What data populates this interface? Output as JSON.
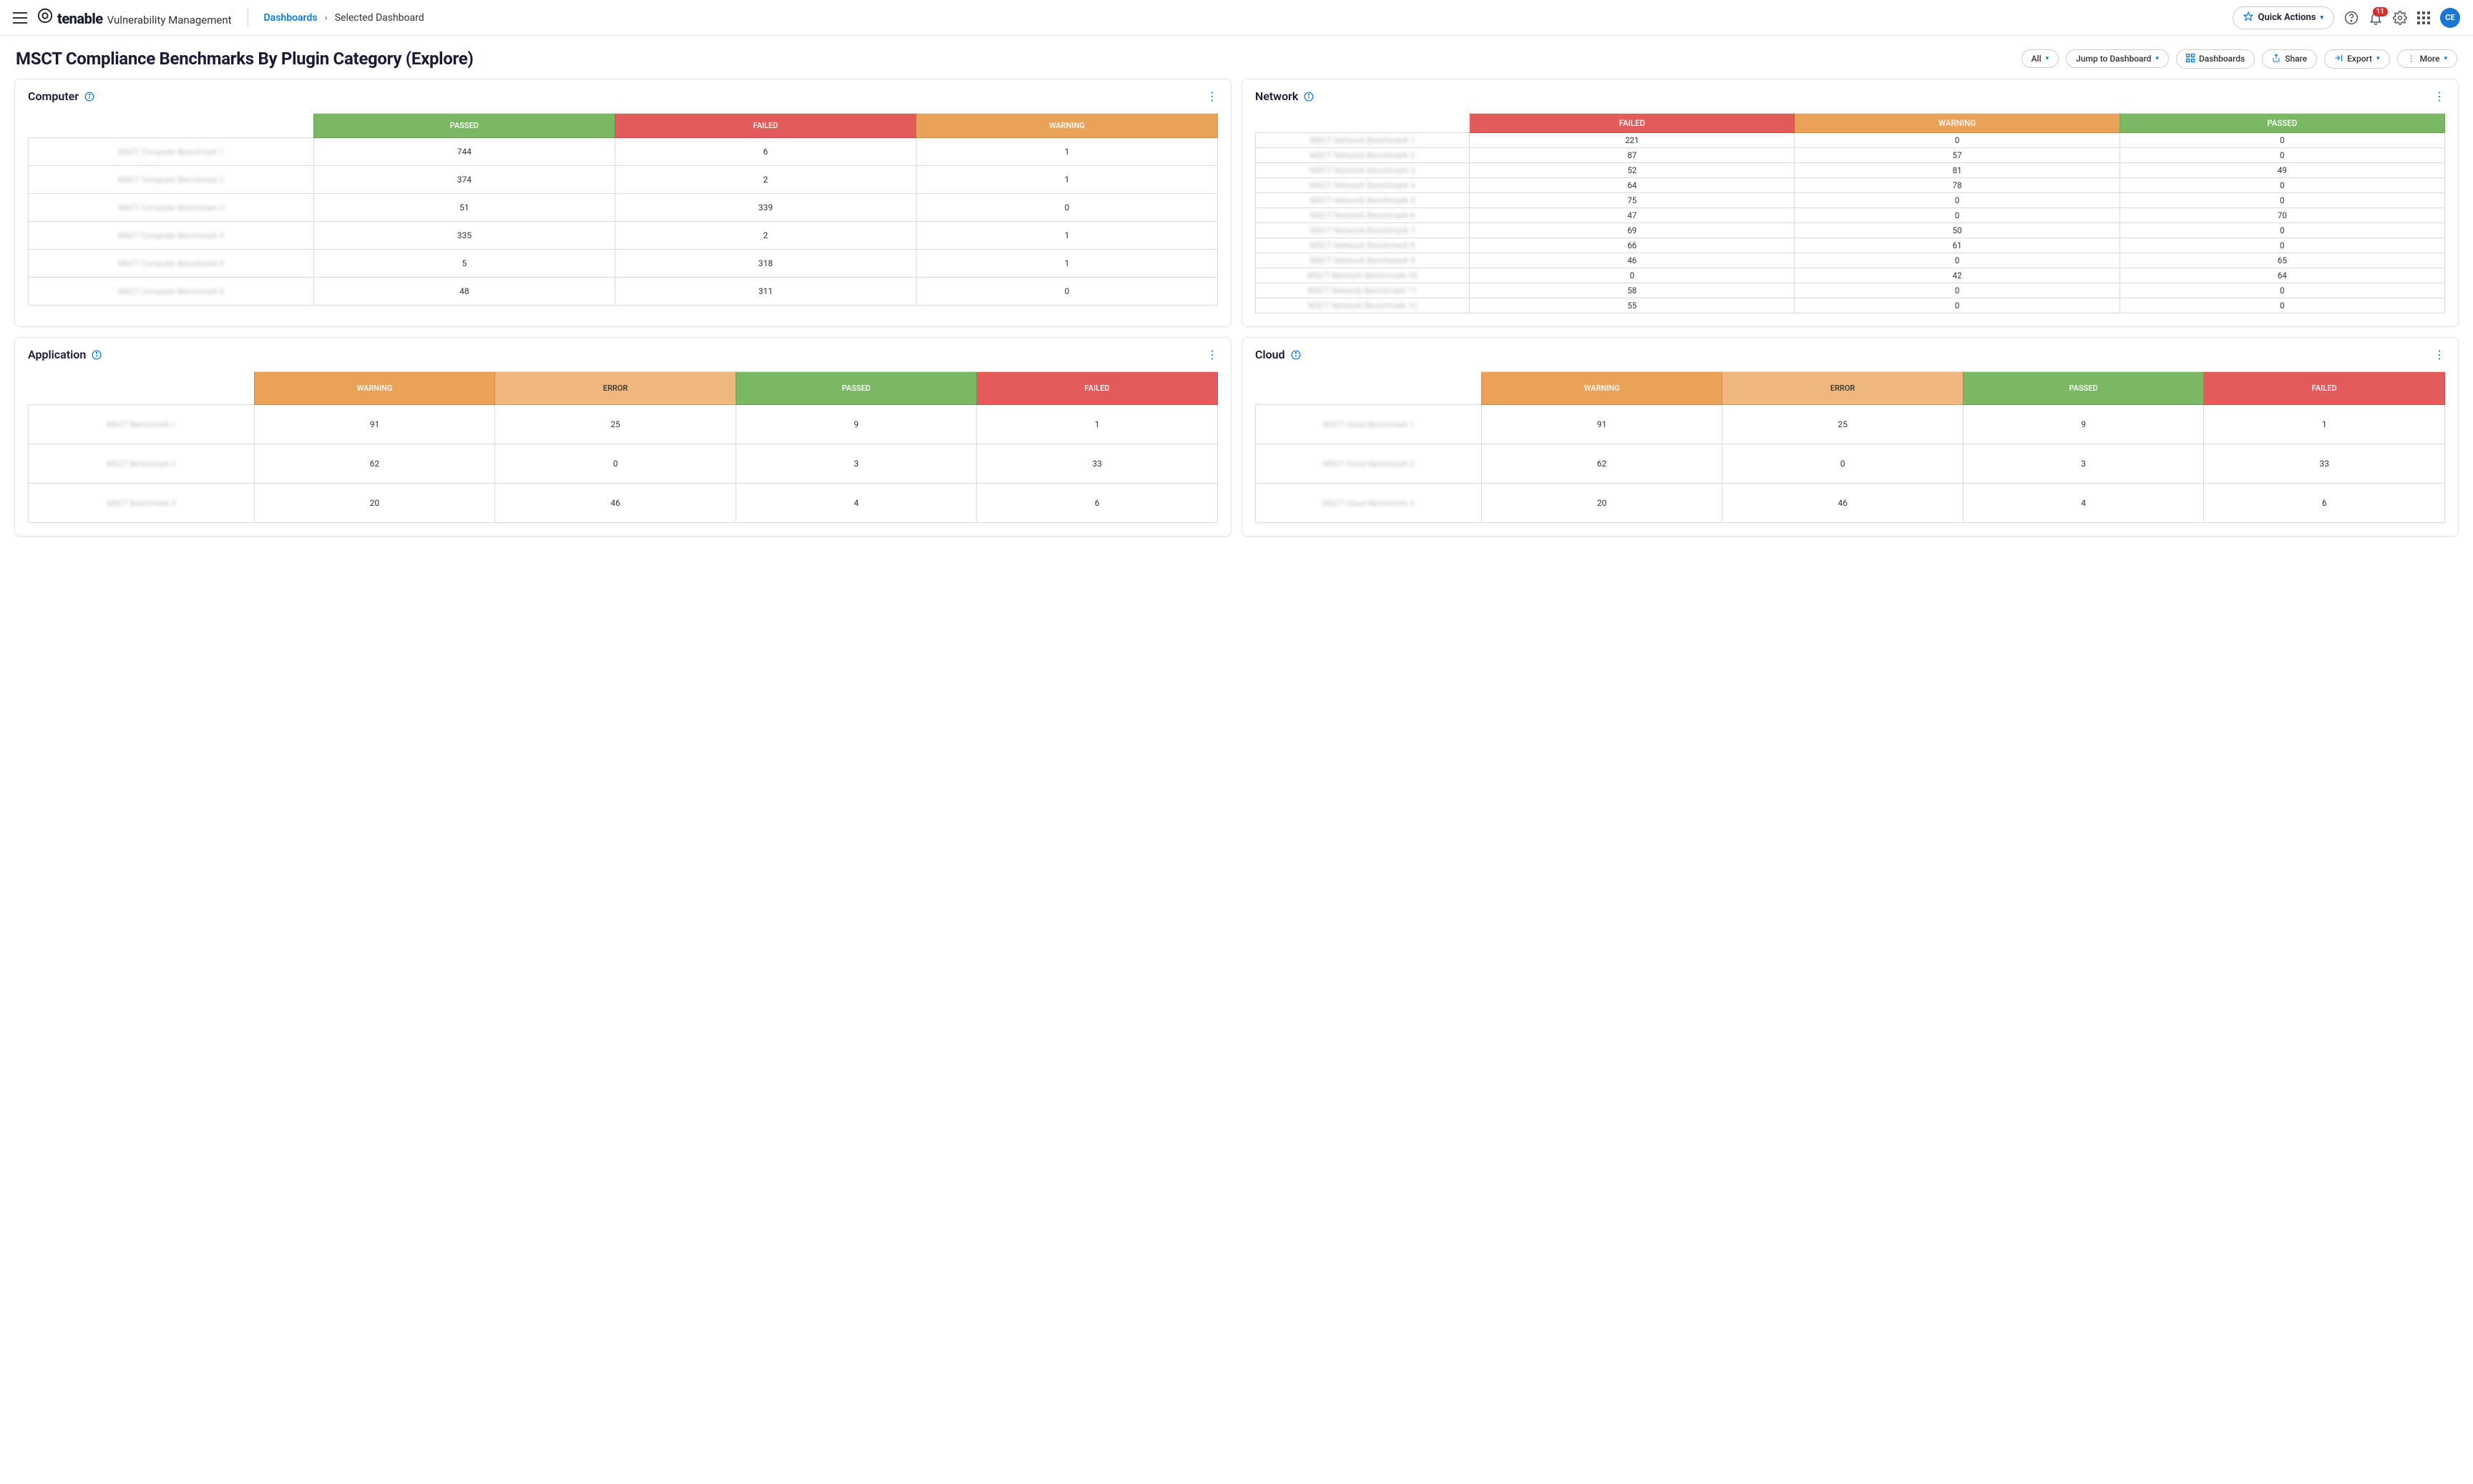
{
  "brand": {
    "name": "tenable",
    "sub": "Vulnerability Management"
  },
  "breadcrumb": {
    "root": "Dashboards",
    "current": "Selected Dashboard"
  },
  "header": {
    "quick_actions": "Quick Actions",
    "notif_count": "11",
    "avatar": "CE"
  },
  "page_title": "MSCT Compliance Benchmarks By Plugin Category (Explore)",
  "toolbar": {
    "all": "All",
    "jump": "Jump to Dashboard",
    "dashboards": "Dashboards",
    "share": "Share",
    "export": "Export",
    "more": "More"
  },
  "status_labels": {
    "passed": "PASSED",
    "failed": "FAILED",
    "warning": "WARNING",
    "error": "ERROR"
  },
  "widgets": {
    "computer": {
      "title": "Computer",
      "rows": [
        {
          "label": "MSCT Computer Benchmark 1",
          "passed": "744",
          "failed": "6",
          "warning": "1"
        },
        {
          "label": "MSCT Computer Benchmark 2",
          "passed": "374",
          "failed": "2",
          "warning": "1"
        },
        {
          "label": "MSCT Computer Benchmark 3",
          "passed": "51",
          "failed": "339",
          "warning": "0"
        },
        {
          "label": "MSCT Computer Benchmark 4",
          "passed": "335",
          "failed": "2",
          "warning": "1"
        },
        {
          "label": "MSCT Computer Benchmark 5",
          "passed": "5",
          "failed": "318",
          "warning": "1"
        },
        {
          "label": "MSCT Computer Benchmark 6",
          "passed": "48",
          "failed": "311",
          "warning": "0"
        }
      ]
    },
    "network": {
      "title": "Network",
      "rows": [
        {
          "label": "MSCT Network Benchmark 1",
          "failed": "221",
          "warning": "0",
          "passed": "0"
        },
        {
          "label": "MSCT Network Benchmark 2",
          "failed": "87",
          "warning": "57",
          "passed": "0"
        },
        {
          "label": "MSCT Network Benchmark 3",
          "failed": "52",
          "warning": "81",
          "passed": "49"
        },
        {
          "label": "MSCT Network Benchmark 4",
          "failed": "64",
          "warning": "78",
          "passed": "0"
        },
        {
          "label": "MSCT Network Benchmark 5",
          "failed": "75",
          "warning": "0",
          "passed": "0"
        },
        {
          "label": "MSCT Network Benchmark 6",
          "failed": "47",
          "warning": "0",
          "passed": "70"
        },
        {
          "label": "MSCT Network Benchmark 7",
          "failed": "69",
          "warning": "50",
          "passed": "0"
        },
        {
          "label": "MSCT Network Benchmark 8",
          "failed": "66",
          "warning": "61",
          "passed": "0"
        },
        {
          "label": "MSCT Network Benchmark 9",
          "failed": "46",
          "warning": "0",
          "passed": "65"
        },
        {
          "label": "MSCT Network Benchmark 10",
          "failed": "0",
          "warning": "42",
          "passed": "64"
        },
        {
          "label": "MSCT Network Benchmark 11",
          "failed": "58",
          "warning": "0",
          "passed": "0"
        },
        {
          "label": "MSCT Network Benchmark 12",
          "failed": "55",
          "warning": "0",
          "passed": "0"
        }
      ]
    },
    "application": {
      "title": "Application",
      "rows": [
        {
          "label": "MSCT Benchmark 1",
          "warning": "91",
          "error": "25",
          "passed": "9",
          "failed": "1"
        },
        {
          "label": "MSCT Benchmark 2",
          "warning": "62",
          "error": "0",
          "passed": "3",
          "failed": "33"
        },
        {
          "label": "MSCT Benchmark 3",
          "warning": "20",
          "error": "46",
          "passed": "4",
          "failed": "6"
        }
      ]
    },
    "cloud": {
      "title": "Cloud",
      "rows": [
        {
          "label": "MSCT Cloud Benchmark 1",
          "warning": "91",
          "error": "25",
          "passed": "9",
          "failed": "1"
        },
        {
          "label": "MSCT Cloud Benchmark 2",
          "warning": "62",
          "error": "0",
          "passed": "3",
          "failed": "33"
        },
        {
          "label": "MSCT Cloud Benchmark 3",
          "warning": "20",
          "error": "46",
          "passed": "4",
          "failed": "6"
        }
      ]
    }
  },
  "chart_data": [
    {
      "type": "table",
      "title": "Computer",
      "columns": [
        "PASSED",
        "FAILED",
        "WARNING"
      ],
      "series": [
        {
          "name": "MSCT Computer Benchmark 1",
          "values": [
            744,
            6,
            1
          ]
        },
        {
          "name": "MSCT Computer Benchmark 2",
          "values": [
            374,
            2,
            1
          ]
        },
        {
          "name": "MSCT Computer Benchmark 3",
          "values": [
            51,
            339,
            0
          ]
        },
        {
          "name": "MSCT Computer Benchmark 4",
          "values": [
            335,
            2,
            1
          ]
        },
        {
          "name": "MSCT Computer Benchmark 5",
          "values": [
            5,
            318,
            1
          ]
        },
        {
          "name": "MSCT Computer Benchmark 6",
          "values": [
            48,
            311,
            0
          ]
        }
      ]
    },
    {
      "type": "table",
      "title": "Network",
      "columns": [
        "FAILED",
        "WARNING",
        "PASSED"
      ],
      "series": [
        {
          "name": "MSCT Network Benchmark 1",
          "values": [
            221,
            0,
            0
          ]
        },
        {
          "name": "MSCT Network Benchmark 2",
          "values": [
            87,
            57,
            0
          ]
        },
        {
          "name": "MSCT Network Benchmark 3",
          "values": [
            52,
            81,
            49
          ]
        },
        {
          "name": "MSCT Network Benchmark 4",
          "values": [
            64,
            78,
            0
          ]
        },
        {
          "name": "MSCT Network Benchmark 5",
          "values": [
            75,
            0,
            0
          ]
        },
        {
          "name": "MSCT Network Benchmark 6",
          "values": [
            47,
            0,
            70
          ]
        },
        {
          "name": "MSCT Network Benchmark 7",
          "values": [
            69,
            50,
            0
          ]
        },
        {
          "name": "MSCT Network Benchmark 8",
          "values": [
            66,
            61,
            0
          ]
        },
        {
          "name": "MSCT Network Benchmark 9",
          "values": [
            46,
            0,
            65
          ]
        },
        {
          "name": "MSCT Network Benchmark 10",
          "values": [
            0,
            42,
            64
          ]
        },
        {
          "name": "MSCT Network Benchmark 11",
          "values": [
            58,
            0,
            0
          ]
        },
        {
          "name": "MSCT Network Benchmark 12",
          "values": [
            55,
            0,
            0
          ]
        }
      ]
    },
    {
      "type": "table",
      "title": "Application",
      "columns": [
        "WARNING",
        "ERROR",
        "PASSED",
        "FAILED"
      ],
      "series": [
        {
          "name": "MSCT Benchmark 1",
          "values": [
            91,
            25,
            9,
            1
          ]
        },
        {
          "name": "MSCT Benchmark 2",
          "values": [
            62,
            0,
            3,
            33
          ]
        },
        {
          "name": "MSCT Benchmark 3",
          "values": [
            20,
            46,
            4,
            6
          ]
        }
      ]
    },
    {
      "type": "table",
      "title": "Cloud",
      "columns": [
        "WARNING",
        "ERROR",
        "PASSED",
        "FAILED"
      ],
      "series": [
        {
          "name": "MSCT Cloud Benchmark 1",
          "values": [
            91,
            25,
            9,
            1
          ]
        },
        {
          "name": "MSCT Cloud Benchmark 2",
          "values": [
            62,
            0,
            3,
            33
          ]
        },
        {
          "name": "MSCT Cloud Benchmark 3",
          "values": [
            20,
            46,
            4,
            6
          ]
        }
      ]
    }
  ]
}
